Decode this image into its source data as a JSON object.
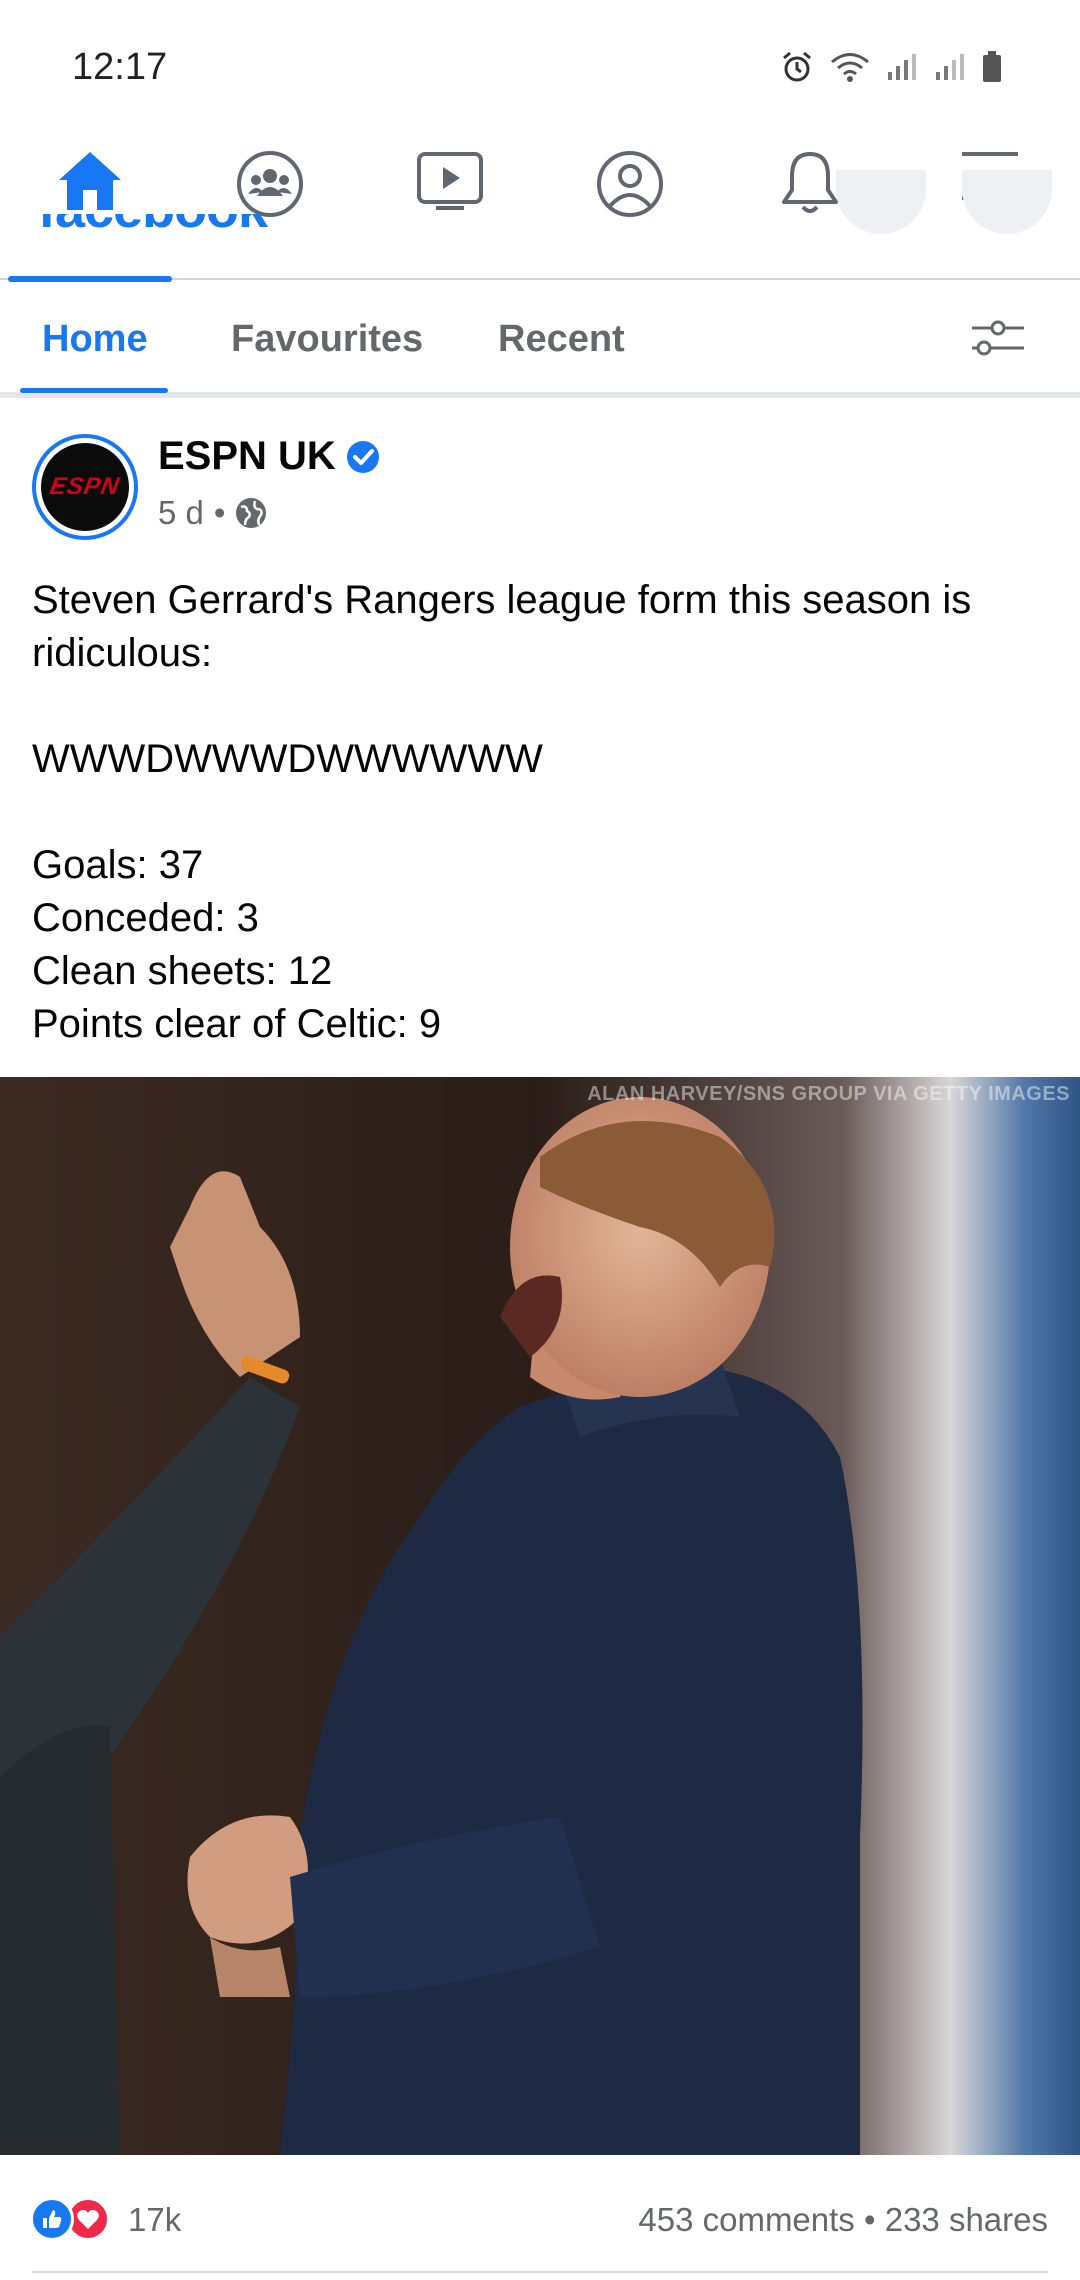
{
  "status_bar": {
    "time": "12:17"
  },
  "app": {
    "logo_text": "facebook"
  },
  "nav": {
    "tabs": [
      {
        "name": "home",
        "icon": "home-icon",
        "active": true
      },
      {
        "name": "groups",
        "icon": "groups-icon",
        "active": false
      },
      {
        "name": "watch",
        "icon": "video-icon",
        "active": false
      },
      {
        "name": "profile",
        "icon": "profile-icon",
        "active": false
      },
      {
        "name": "notifications",
        "icon": "bell-icon",
        "active": false
      },
      {
        "name": "menu",
        "icon": "menu-icon",
        "active": false
      }
    ],
    "accent_color": "#1877f2"
  },
  "feed_tabs": {
    "items": [
      {
        "label": "Home",
        "active": true
      },
      {
        "label": "Favourites",
        "active": false
      },
      {
        "label": "Recent",
        "active": false
      }
    ],
    "filter_icon": "sliders-icon"
  },
  "post": {
    "page_name": "ESPN UK",
    "verified": true,
    "avatar_text": "ESPN",
    "time": "5 d",
    "separator": "•",
    "audience_icon": "globe-icon",
    "text_lines": [
      "Steven Gerrard's Rangers league form this season is ridiculous:",
      "",
      "WWWDWWWDWWWWWW",
      "",
      "Goals: 37",
      "Conceded: 3",
      "Clean sheets: 12",
      "Points clear of Celtic: 9"
    ],
    "image": {
      "credit": "ALAN HARVEY/SNS GROUP VIA GETTY IMAGES"
    },
    "reactions": {
      "icons": [
        "like-icon",
        "love-icon"
      ],
      "count": "17k"
    },
    "comments": "453 comments",
    "shares": "233 shares",
    "stats_separator": "•"
  }
}
